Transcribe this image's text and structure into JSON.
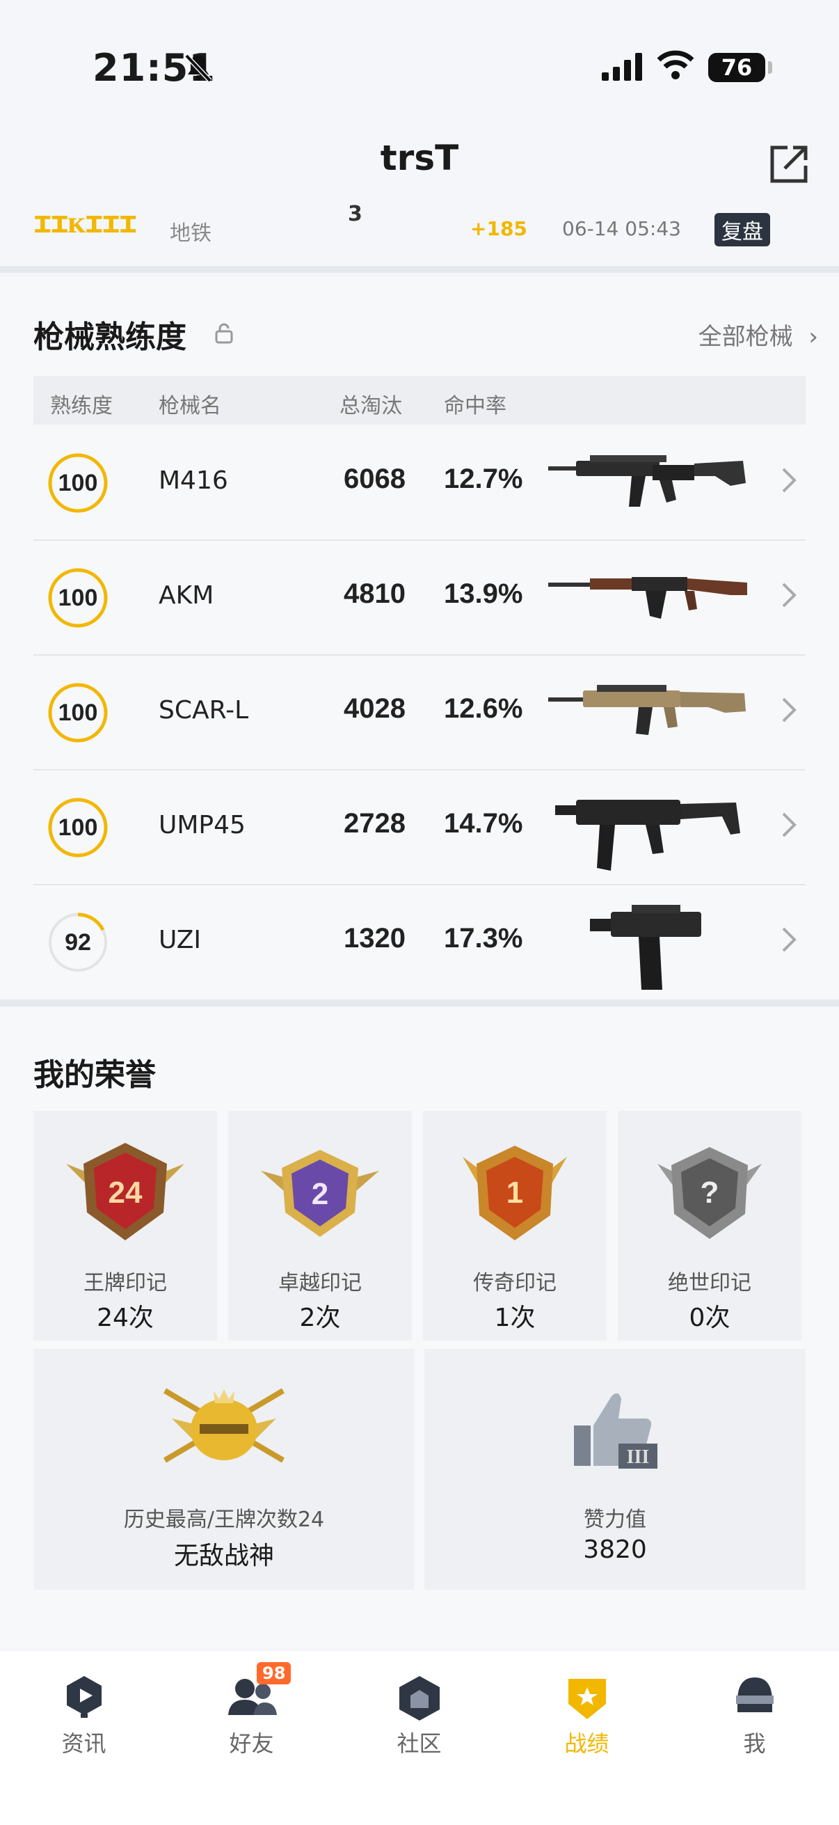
{
  "status": {
    "time": "21:51",
    "battery": "76"
  },
  "header": {
    "title": "trsT"
  },
  "match": {
    "mode": "地铁",
    "kills": "3",
    "score_delta": "+185",
    "time": "06-14 05:43",
    "replay_label": "复盘"
  },
  "weapons": {
    "title": "枪械熟练度",
    "all_label": "全部枪械",
    "columns": [
      "熟练度",
      "枪械名",
      "总淘汰",
      "命中率"
    ],
    "rows": [
      {
        "level": "100",
        "level_fraction": 1.0,
        "name": "M416",
        "kills": "6068",
        "accuracy": "12.7%"
      },
      {
        "level": "100",
        "level_fraction": 1.0,
        "name": "AKM",
        "kills": "4810",
        "accuracy": "13.9%"
      },
      {
        "level": "100",
        "level_fraction": 1.0,
        "name": "SCAR-L",
        "kills": "4028",
        "accuracy": "12.6%"
      },
      {
        "level": "100",
        "level_fraction": 1.0,
        "name": "UMP45",
        "kills": "2728",
        "accuracy": "14.7%"
      },
      {
        "level": "92",
        "level_fraction": 0.2,
        "name": "UZI",
        "kills": "1320",
        "accuracy": "17.3%"
      }
    ]
  },
  "honor": {
    "title": "我的荣誉",
    "marks": [
      {
        "label": "王牌印记",
        "value": "24次",
        "badge_text": "24"
      },
      {
        "label": "卓越印记",
        "value": "2次",
        "badge_text": "2"
      },
      {
        "label": "传奇印记",
        "value": "1次",
        "badge_text": "1"
      },
      {
        "label": "绝世印记",
        "value": "0次",
        "badge_text": "?"
      }
    ],
    "highest": {
      "label": "历史最高/王牌次数24",
      "value": "无敌战神"
    },
    "likes": {
      "label": "赞力值",
      "value": "3820"
    }
  },
  "tabs": [
    {
      "label": "资讯",
      "icon": "news-icon"
    },
    {
      "label": "好友",
      "icon": "friends-icon",
      "badge": "98"
    },
    {
      "label": "社区",
      "icon": "community-icon"
    },
    {
      "label": "战绩",
      "icon": "record-icon",
      "active": true
    },
    {
      "label": "我",
      "icon": "me-icon"
    }
  ],
  "colors": {
    "accent": "#f2b700",
    "badge": "#ff6a2c"
  }
}
